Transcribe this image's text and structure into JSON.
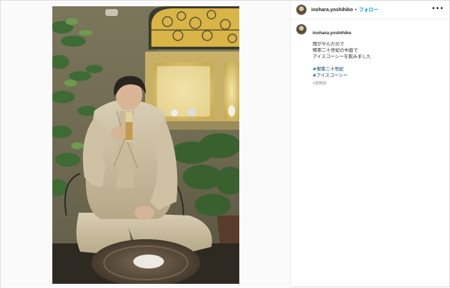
{
  "header": {
    "username": "inohara.yoshihiko",
    "separator": "•",
    "follow_label": "フォロー",
    "more_icon": "more-options-icon"
  },
  "caption": {
    "username": "inohara.yoshihiko",
    "lines": [
      "雨がやんだので",
      "喫茶二十世紀の中庭で",
      "アイスコーシーを飲みました"
    ],
    "hashtags": [
      "#喫茶二十世紀",
      "#アイスコーシー"
    ],
    "time_ago": "4週間前"
  },
  "media": {
    "photo_icon": "post-photo"
  },
  "colors": {
    "follow": "#0095f6",
    "hashtag": "#00376b",
    "text": "#262626",
    "muted": "#8e8e8e"
  }
}
